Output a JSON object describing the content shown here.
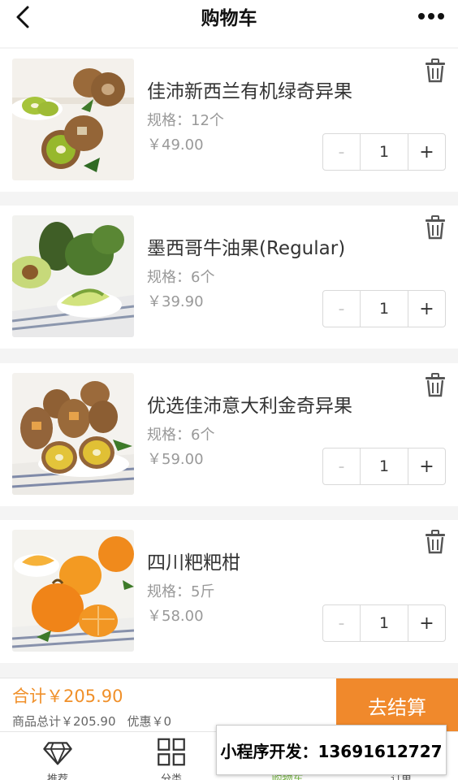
{
  "header": {
    "title": "购物车",
    "back_icon": "chevron-left-icon",
    "more_icon": "more-dots-icon"
  },
  "cart": {
    "items": [
      {
        "name": "佳沛新西兰有机绿奇异果",
        "spec": "规格：12个",
        "price": "￥49.00",
        "quantity": "1",
        "minus": "-",
        "plus": "+",
        "image": "green-kiwi-photo"
      },
      {
        "name": "墨西哥牛油果(Regular)",
        "spec": "规格：6个",
        "price": "￥39.90",
        "quantity": "1",
        "minus": "-",
        "plus": "+",
        "image": "avocado-photo"
      },
      {
        "name": "优选佳沛意大利金奇异果",
        "spec": "规格：6个",
        "price": "￥59.00",
        "quantity": "1",
        "minus": "-",
        "plus": "+",
        "image": "golden-kiwi-photo"
      },
      {
        "name": "四川粑粑柑",
        "spec": "规格：5斤",
        "price": "￥58.00",
        "quantity": "1",
        "minus": "-",
        "plus": "+",
        "image": "orange-photo"
      }
    ]
  },
  "checkout": {
    "total": "合计￥205.90",
    "goods_total": "商品总计￥205.90",
    "discount": "优惠￥0",
    "button": "去结算"
  },
  "tabbar": {
    "tabs": [
      {
        "label": "推荐",
        "icon": "diamond-icon"
      },
      {
        "label": "分类",
        "icon": "grid-icon"
      },
      {
        "label": "购物车",
        "icon": "cart-icon"
      },
      {
        "label": "订单",
        "icon": "order-icon"
      }
    ]
  },
  "watermark": {
    "text": "小程序开发：13691612727"
  },
  "colors": {
    "accent": "#f0892c",
    "total_text": "#f0902a",
    "active_tab": "#74b341"
  }
}
